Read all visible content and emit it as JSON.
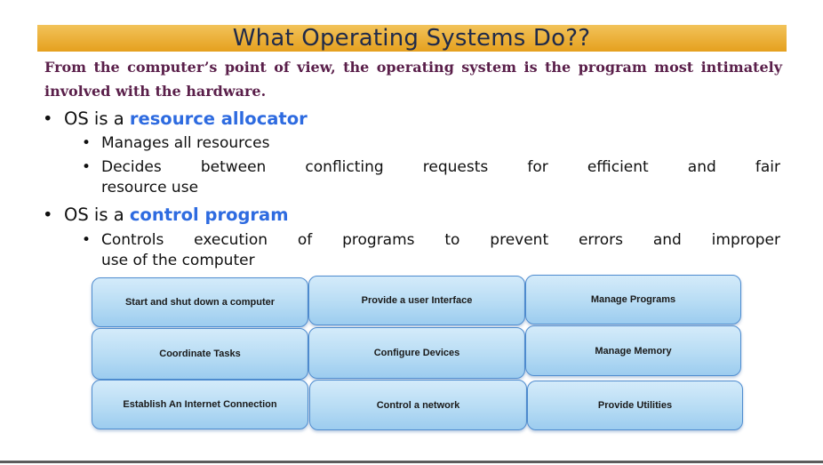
{
  "title": "What Operating Systems Do??",
  "intro": "From the computer’s point of view, the operating system is the program most intimately involved with the hardware.",
  "bullet_glyph": "•",
  "bullets": [
    {
      "prefix": "OS is a ",
      "highlight": "resource allocator"
    },
    {
      "prefix": "OS is a ",
      "highlight": "control program"
    }
  ],
  "subbullets": [
    {
      "line1": "Manages all resources"
    },
    {
      "line1": "Decides between conflicting requests for efficient and fair",
      "line2": "resource use"
    },
    {
      "line1": "Controls execution of programs to prevent errors and improper",
      "line2": "use of the computer"
    }
  ],
  "diagram_boxes": [
    "Start and shut down a computer",
    "Provide a user Interface",
    "Manage Programs",
    "Coordinate Tasks",
    "Configure Devices",
    "Manage Memory",
    "Establish An Internet Connection",
    "Control a network",
    "Provide Utilities"
  ],
  "colors": {
    "title_band": "#e5a01e",
    "title_text": "#1f2a4a",
    "intro_text": "#5a1f4a",
    "highlight": "#2e6be0",
    "box_fill": "#b7dcf4",
    "box_border": "#4f8ccf"
  }
}
